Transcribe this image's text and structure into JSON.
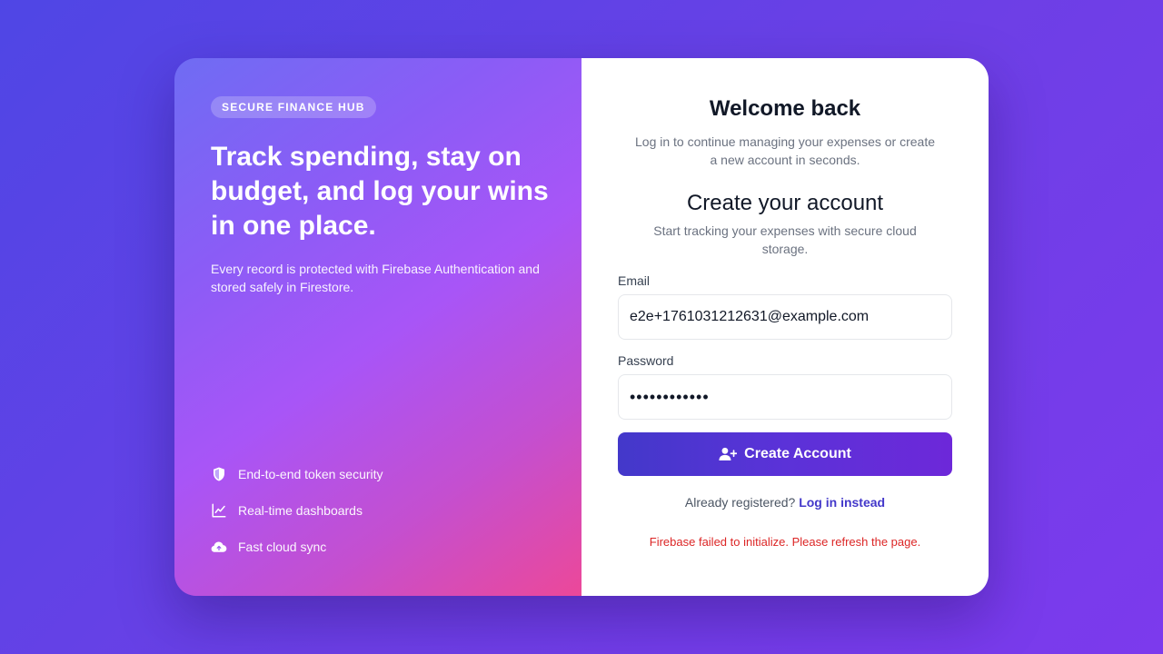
{
  "hero": {
    "badge": "SECURE FINANCE HUB",
    "headline": "Track spending, stay on budget, and log your wins in one place.",
    "subcopy": "Every record is protected with Firebase Authentication and stored safely in Firestore.",
    "features": [
      {
        "icon": "shield-icon",
        "label": "End-to-end token security"
      },
      {
        "icon": "chart-line-icon",
        "label": "Real-time dashboards"
      },
      {
        "icon": "cloud-upload-icon",
        "label": "Fast cloud sync"
      }
    ]
  },
  "auth": {
    "welcome_title": "Welcome back",
    "welcome_sub": "Log in to continue managing your expenses or create a new account in seconds.",
    "form_title": "Create your account",
    "form_sub": "Start tracking your expenses with secure cloud storage.",
    "email_label": "Email",
    "email_value": "e2e+1761031212631@example.com",
    "password_label": "Password",
    "password_value": "Password123!",
    "submit_label": "Create Account",
    "switch_prompt": "Already registered?",
    "switch_link": "Log in instead",
    "error": "Firebase failed to initialize. Please refresh the page."
  },
  "colors": {
    "accent": "#4338ca",
    "error": "#dc2626",
    "background": "#5b3fe6"
  }
}
